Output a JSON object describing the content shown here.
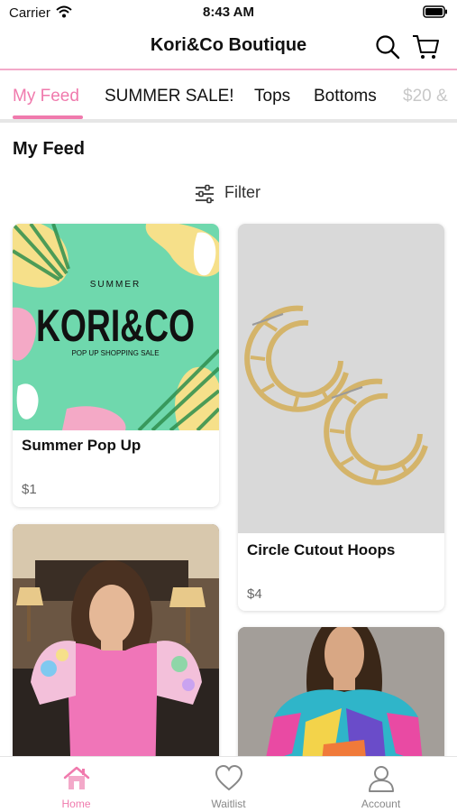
{
  "status": {
    "carrier": "Carrier",
    "time": "8:43 AM"
  },
  "header": {
    "title": "Kori&Co Boutique"
  },
  "tabs": [
    {
      "label": "My Feed"
    },
    {
      "label": "SUMMER SALE!"
    },
    {
      "label": "Tops"
    },
    {
      "label": "Bottoms"
    },
    {
      "label": "$20 &"
    }
  ],
  "feed": {
    "title": "My Feed",
    "filter_label": "Filter"
  },
  "promo": {
    "small": "SUMMER",
    "big": "KORI&CO",
    "sub": "POP UP SHOPPING SALE"
  },
  "products": [
    {
      "title": "Summer Pop Up",
      "price": "$1"
    },
    {
      "title": "Circle Cutout Hoops",
      "price": "$4"
    }
  ],
  "tab_bar": {
    "home": "Home",
    "waitlist": "Waitlist",
    "account": "Account"
  },
  "colors": {
    "accent": "#f07aad",
    "divider": "#f3a9c9",
    "promo_bg": "#6fd8ad"
  }
}
